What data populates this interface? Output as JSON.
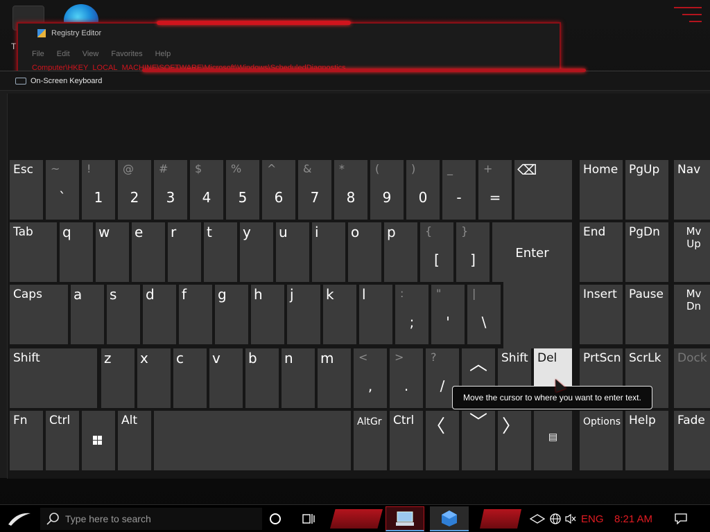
{
  "desktop": {
    "icon_label_partial": "T"
  },
  "registry_editor": {
    "title": "Registry Editor",
    "menu": [
      "File",
      "Edit",
      "View",
      "Favorites",
      "Help"
    ],
    "address": "Computer\\HKEY_LOCAL_MACHINE\\SOFTWARE\\Microsoft\\Windows\\ScheduledDiagnostics"
  },
  "keyboard": {
    "title": "On-Screen Keyboard",
    "row1": {
      "esc": "Esc",
      "digits": [
        {
          "shift": "~",
          "main": "`"
        },
        {
          "shift": "!",
          "main": "1"
        },
        {
          "shift": "@",
          "main": "2"
        },
        {
          "shift": "#",
          "main": "3"
        },
        {
          "shift": "$",
          "main": "4"
        },
        {
          "shift": "%",
          "main": "5"
        },
        {
          "shift": "^",
          "main": "6"
        },
        {
          "shift": "&",
          "main": "7"
        },
        {
          "shift": "*",
          "main": "8"
        },
        {
          "shift": "(",
          "main": "9"
        },
        {
          "shift": ")",
          "main": "0"
        },
        {
          "shift": "_",
          "main": "-"
        },
        {
          "shift": "+",
          "main": "="
        }
      ],
      "backspace_icon": "backspace-icon",
      "home": "Home",
      "pgup": "PgUp",
      "nav": "Nav"
    },
    "row2": {
      "tab": "Tab",
      "letters": [
        "q",
        "w",
        "e",
        "r",
        "t",
        "y",
        "u",
        "i",
        "o",
        "p"
      ],
      "brackets": [
        {
          "shift": "{",
          "main": "["
        },
        {
          "shift": "}",
          "main": "]"
        }
      ],
      "enter": "Enter",
      "end": "End",
      "pgdn": "PgDn",
      "mvup": "Mv Up"
    },
    "row3": {
      "caps": "Caps",
      "letters": [
        "a",
        "s",
        "d",
        "f",
        "g",
        "h",
        "j",
        "k",
        "l"
      ],
      "punct": [
        {
          "shift": ":",
          "main": ";"
        },
        {
          "shift": "\"",
          "main": "'"
        },
        {
          "shift": "|",
          "main": "\\"
        }
      ],
      "insert": "Insert",
      "pause": "Pause",
      "mvdn": "Mv Dn"
    },
    "row4": {
      "shift": "Shift",
      "letters": [
        "z",
        "x",
        "c",
        "v",
        "b",
        "n",
        "m"
      ],
      "punct": [
        {
          "shift": "<",
          "main": ","
        },
        {
          "shift": ">",
          "main": "."
        },
        {
          "shift": "?",
          "main": "/"
        }
      ],
      "up_icon": "arrow-up-icon",
      "shift_right": "Shift",
      "del": "Del",
      "prtscn": "PrtScn",
      "scrlk": "ScrLk",
      "dock": "Dock"
    },
    "row5": {
      "fn": "Fn",
      "ctrl": "Ctrl",
      "win_icon": "windows-logo-icon",
      "alt": "Alt",
      "altgr": "AltGr",
      "ctrl_right": "Ctrl",
      "left_icon": "arrow-left-icon",
      "down_icon": "arrow-down-icon",
      "right_icon": "arrow-right-icon",
      "menu_icon": "context-menu-icon",
      "options": "Options",
      "help": "Help",
      "fade": "Fade"
    },
    "tooltip": "Move the cursor to where you want to enter text."
  },
  "taskbar": {
    "search_placeholder": "Type here to search",
    "language": "ENG",
    "time": "8:21 AM",
    "accent_color": "#e11b22"
  }
}
